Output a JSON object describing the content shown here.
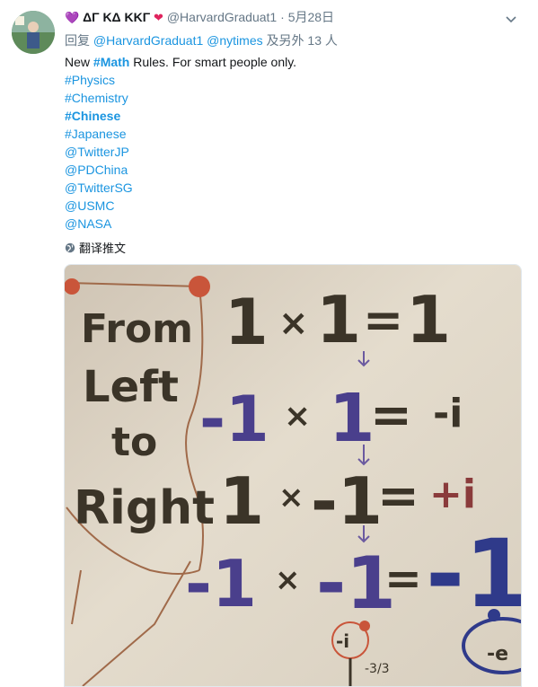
{
  "tweet": {
    "display_name": "ΔΓ ΚΔ ΚΚΓ",
    "handle": "@HarvardGraduat1",
    "separator": "·",
    "timestamp": "5月28日",
    "reply_prefix": "回复",
    "reply_mentions": [
      "@HarvardGraduat1",
      "@nytimes"
    ],
    "reply_suffix": "及另外 13 人",
    "text_lines": [
      {
        "prefix": "New ",
        "tag": "#Math",
        "suffix": " Rules. For smart people only."
      },
      {
        "tag": "#Physics"
      },
      {
        "tag": "#Chemistry"
      },
      {
        "tag": "#Chinese"
      },
      {
        "tag": "#Japanese"
      },
      {
        "tag": "@TwitterJP"
      },
      {
        "tag": "@PDChina"
      },
      {
        "tag": "@TwitterSG"
      },
      {
        "tag": "@USMC"
      },
      {
        "tag": "@NASA"
      }
    ],
    "translate_label": "翻译推文"
  },
  "image": {
    "left_words": [
      "From",
      "Left",
      "to",
      "Right"
    ],
    "rows": [
      {
        "a": "1",
        "op": "×",
        "b": "1",
        "eq": "=",
        "r": "1"
      },
      {
        "a": "-1",
        "op": "×",
        "b": "1",
        "eq": "=",
        "r": "-i"
      },
      {
        "a": "1",
        "op": "×",
        "b": "-1",
        "eq": "=",
        "r": "+i"
      },
      {
        "a": "-1",
        "op": "×",
        "b": "-1",
        "eq": "=",
        "r": "-1"
      }
    ],
    "circle_label": "-i",
    "fraction": "-3/3",
    "corner_label": "-e"
  },
  "colors": {
    "accent": "#1b95e0",
    "muted": "#657786",
    "whiteboard": "#d9d0c0"
  },
  "icons": {
    "heart_left": "purple-heart-icon",
    "heart_right": "red-heart-icon",
    "menu": "chevron-down-icon",
    "translate": "globe-icon"
  }
}
